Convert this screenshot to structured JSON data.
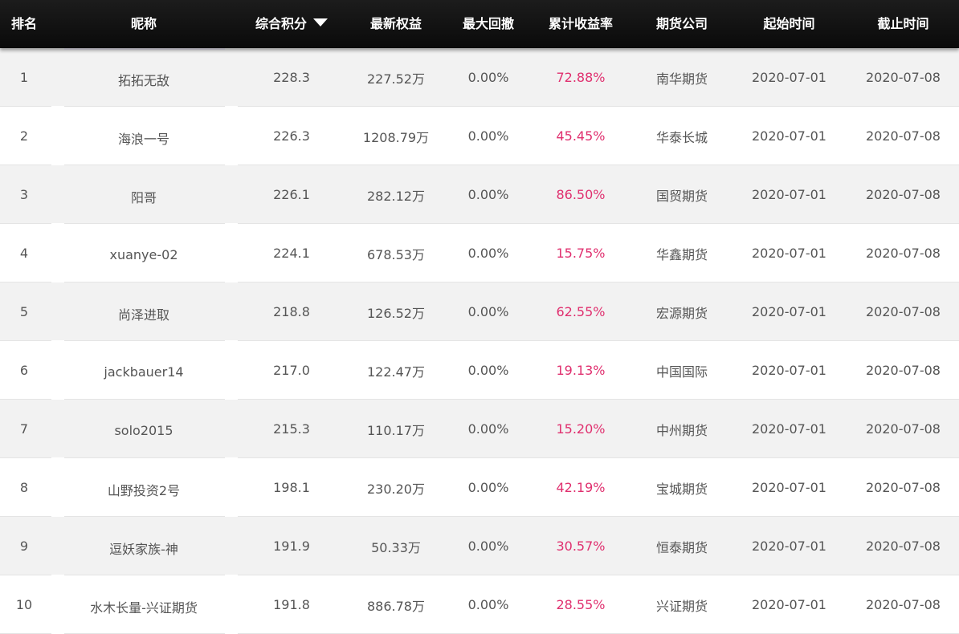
{
  "header": {
    "rank": "排名",
    "nickname": "昵称",
    "score": "综合积分",
    "equity": "最新权益",
    "drawdown": "最大回撤",
    "return": "累计收益率",
    "company": "期货公司",
    "start": "起始时间",
    "end": "截止时间"
  },
  "sort_icon": "triangle-down-icon",
  "colors": {
    "header_bg": "#111111",
    "row_alt_bg": "#f2f2f2",
    "text": "#555555",
    "return_text": "#e0306f"
  },
  "rows": [
    {
      "rank": "1",
      "nickname": "拓拓无敌",
      "score": "228.3",
      "equity": "227.52万",
      "drawdown": "0.00%",
      "return": "72.88%",
      "company": "南华期货",
      "start": "2020-07-01",
      "end": "2020-07-08"
    },
    {
      "rank": "2",
      "nickname": "海浪一号",
      "score": "226.3",
      "equity": "1208.79万",
      "drawdown": "0.00%",
      "return": "45.45%",
      "company": "华泰长城",
      "start": "2020-07-01",
      "end": "2020-07-08"
    },
    {
      "rank": "3",
      "nickname": "阳哥",
      "score": "226.1",
      "equity": "282.12万",
      "drawdown": "0.00%",
      "return": "86.50%",
      "company": "国贸期货",
      "start": "2020-07-01",
      "end": "2020-07-08"
    },
    {
      "rank": "4",
      "nickname": "xuanye-02",
      "score": "224.1",
      "equity": "678.53万",
      "drawdown": "0.00%",
      "return": "15.75%",
      "company": "华鑫期货",
      "start": "2020-07-01",
      "end": "2020-07-08"
    },
    {
      "rank": "5",
      "nickname": "尚泽进取",
      "score": "218.8",
      "equity": "126.52万",
      "drawdown": "0.00%",
      "return": "62.55%",
      "company": "宏源期货",
      "start": "2020-07-01",
      "end": "2020-07-08"
    },
    {
      "rank": "6",
      "nickname": "jackbauer14",
      "score": "217.0",
      "equity": "122.47万",
      "drawdown": "0.00%",
      "return": "19.13%",
      "company": "中国国际",
      "start": "2020-07-01",
      "end": "2020-07-08"
    },
    {
      "rank": "7",
      "nickname": "solo2015",
      "score": "215.3",
      "equity": "110.17万",
      "drawdown": "0.00%",
      "return": "15.20%",
      "company": "中州期货",
      "start": "2020-07-01",
      "end": "2020-07-08"
    },
    {
      "rank": "8",
      "nickname": "山野投资2号",
      "score": "198.1",
      "equity": "230.20万",
      "drawdown": "0.00%",
      "return": "42.19%",
      "company": "宝城期货",
      "start": "2020-07-01",
      "end": "2020-07-08"
    },
    {
      "rank": "9",
      "nickname": "逗妖家族-神",
      "score": "191.9",
      "equity": "50.33万",
      "drawdown": "0.00%",
      "return": "30.57%",
      "company": "恒泰期货",
      "start": "2020-07-01",
      "end": "2020-07-08"
    },
    {
      "rank": "10",
      "nickname": "水木长量-兴证期货",
      "score": "191.8",
      "equity": "886.78万",
      "drawdown": "0.00%",
      "return": "28.55%",
      "company": "兴证期货",
      "start": "2020-07-01",
      "end": "2020-07-08"
    }
  ]
}
